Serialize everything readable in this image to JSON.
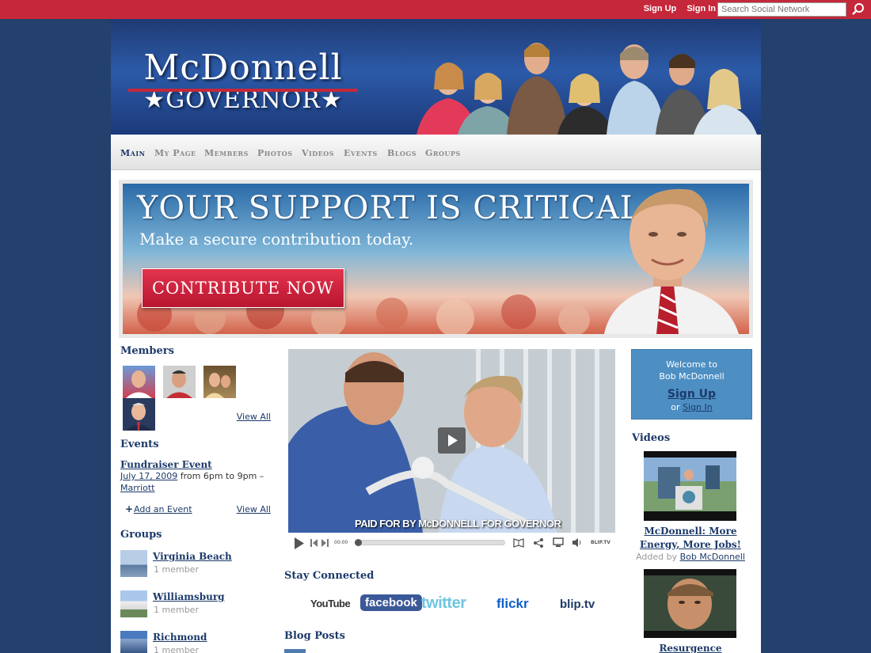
{
  "topbar": {
    "signup": "Sign Up",
    "signin": "Sign In",
    "search_placeholder": "Search Social Network"
  },
  "logo": {
    "line1": "McDonnell",
    "line2": "GOVERNOR"
  },
  "nav": [
    "Main",
    "My Page",
    "Members",
    "Photos",
    "Videos",
    "Events",
    "Blogs",
    "Groups"
  ],
  "banner": {
    "headline": "YOUR SUPPORT IS CRITICAL.",
    "subline": "Make a secure contribution today.",
    "cta": "CONTRIBUTE NOW"
  },
  "members": {
    "heading": "Members",
    "view_all": "View All"
  },
  "events": {
    "heading": "Events",
    "title": "Fundraiser Event",
    "date": "July 17, 2009",
    "time": " from 6pm to 9pm – ",
    "location": "Marriott",
    "add": "Add an Event",
    "view_all": "View All"
  },
  "groups": {
    "heading": "Groups",
    "items": [
      {
        "name": "Virginia Beach",
        "count": "1 member"
      },
      {
        "name": "Williamsburg",
        "count": "1 member"
      },
      {
        "name": "Richmond",
        "count": "1 member"
      }
    ]
  },
  "video": {
    "caption": "PAID FOR BY McDONNELL FOR GOVERNOR",
    "time": "00:00",
    "brand": "BLIP.TV"
  },
  "stay_connected": {
    "heading": "Stay Connected",
    "services": [
      "YouTube",
      "facebook",
      "twitter",
      "flickr",
      "blip.tv"
    ]
  },
  "blog_posts": {
    "heading": "Blog Posts"
  },
  "welcome": {
    "line1": "Welcome to",
    "line2": "Bob McDonnell",
    "signup": "Sign Up",
    "or": "or ",
    "signin": "Sign In"
  },
  "videos": {
    "heading": "Videos",
    "items": [
      {
        "title": "McDonnell: More Energy, More Jobs!",
        "added_by_label": "Added by ",
        "added_by": "Bob McDonnell"
      },
      {
        "title": "Resurgence"
      }
    ]
  },
  "colors": {
    "topbar": "#c5283a",
    "background": "#24406d",
    "accent": "#1c3a6a",
    "welcome_box": "#4d8fc3"
  }
}
